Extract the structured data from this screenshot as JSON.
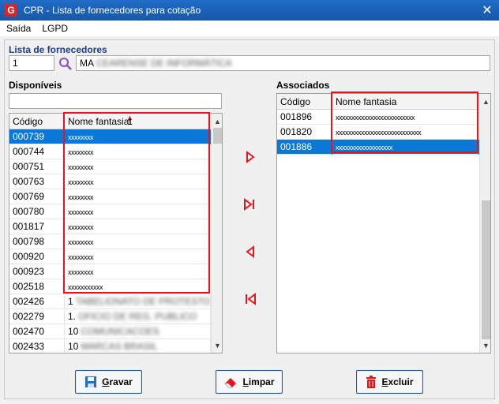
{
  "window": {
    "title": "CPR - Lista de fornecedores para cotação",
    "close": "✕",
    "logo": "G"
  },
  "menu": [
    "Saída",
    "LGPD"
  ],
  "lista": {
    "label": "Lista de fornecedores",
    "code": "1",
    "name_prefix": "MA",
    "name_blurred": "CEARENSE DE INFORMÁTICA"
  },
  "disponiveis": {
    "label": "Disponíveis",
    "filter": "",
    "headers": [
      "Código",
      "Nome fantasia"
    ],
    "sort_index": "1",
    "rows": [
      {
        "code": "000739",
        "name": "xxxxxxxx",
        "selected": true
      },
      {
        "code": "000744",
        "name": "xxxxxxxx"
      },
      {
        "code": "000751",
        "name": "xxxxxxxx"
      },
      {
        "code": "000763",
        "name": "xxxxxxxx"
      },
      {
        "code": "000769",
        "name": "xxxxxxxx"
      },
      {
        "code": "000780",
        "name": "xxxxxxxx"
      },
      {
        "code": "001817",
        "name": "xxxxxxxx"
      },
      {
        "code": "000798",
        "name": "xxxxxxxx"
      },
      {
        "code": "000920",
        "name": "xxxxxxxx"
      },
      {
        "code": "000923",
        "name": "xxxxxxxx"
      },
      {
        "code": "002518",
        "name": "xxxxxxxxxxx"
      },
      {
        "code": "002426",
        "name": "1",
        "blur": "TABELIONATO DE PROTESTO"
      },
      {
        "code": "002279",
        "name": "1.",
        "blur": "OFICIO DE REG. PUBLICO"
      },
      {
        "code": "002470",
        "name": "10",
        "blur": "COMUNICACOES"
      },
      {
        "code": "002433",
        "name": "10",
        "blur": "MARCAS BRASIL"
      }
    ]
  },
  "associados": {
    "label": "Associados",
    "headers": [
      "Código",
      "Nome fantasia"
    ],
    "rows": [
      {
        "code": "001896",
        "name": "xxxxxxxxxxxxxxxxxxxxxxxxx"
      },
      {
        "code": "001820",
        "name": "xxxxxxxxxxxxxxxxxxxxxxxxxxx"
      },
      {
        "code": "001886",
        "name": "xxxxxxxxxxxxxxxxxx",
        "selected": true
      }
    ]
  },
  "move_buttons": [
    "move-right-icon",
    "move-all-right-icon",
    "move-left-icon",
    "move-all-left-icon"
  ],
  "buttons": {
    "gravar_first": "G",
    "gravar_rest": "ravar",
    "limpar_first": "L",
    "limpar_rest": "impar",
    "excluir_first": "E",
    "excluir_rest": "xcluir"
  },
  "colors": {
    "title_bar": "#1a5fb4",
    "selection": "#0a78d7",
    "highlight": "#e8141b",
    "arrow": "#e8141b"
  }
}
